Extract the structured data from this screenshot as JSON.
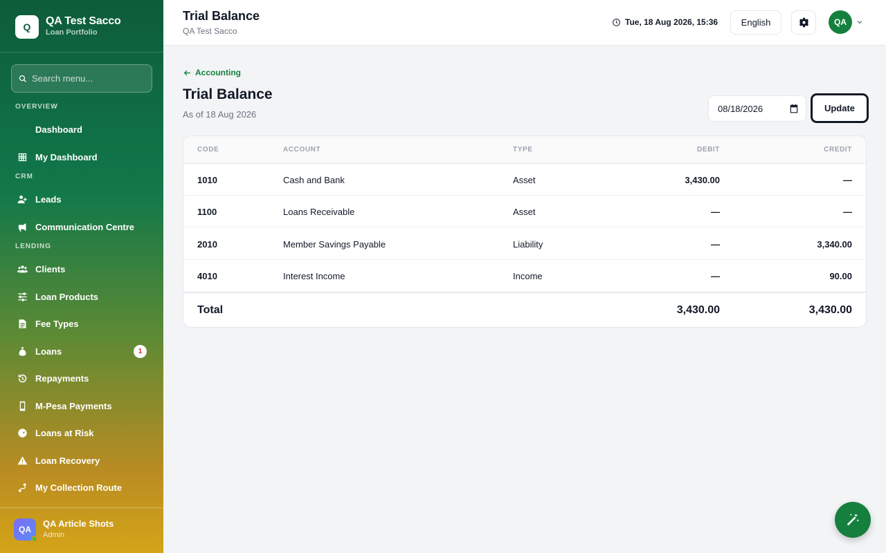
{
  "brand": {
    "logo_letter": "Q",
    "title": "QA Test Sacco",
    "subtitle": "Loan Portfolio"
  },
  "search": {
    "placeholder": "Search menu..."
  },
  "sections": {
    "overview": "OVERVIEW",
    "crm": "CRM",
    "lending": "LENDING"
  },
  "nav": [
    {
      "label": "Dashboard",
      "icon": "none"
    },
    {
      "label": "My Dashboard",
      "icon": "grid-icon"
    },
    {
      "label": "Leads",
      "icon": "user-plus-icon"
    },
    {
      "label": "Communication Centre",
      "icon": "megaphone-icon"
    },
    {
      "label": "Clients",
      "icon": "users-icon"
    },
    {
      "label": "Loan Products",
      "icon": "sliders-icon"
    },
    {
      "label": "Fee Types",
      "icon": "document-icon"
    },
    {
      "label": "Loans",
      "icon": "money-bag-icon",
      "badge": "1"
    },
    {
      "label": "Repayments",
      "icon": "history-icon"
    },
    {
      "label": "M-Pesa Payments",
      "icon": "mobile-icon"
    },
    {
      "label": "Loans at Risk",
      "icon": "gauge-icon"
    },
    {
      "label": "Loan Recovery",
      "icon": "warning-icon"
    },
    {
      "label": "My Collection Route",
      "icon": "route-icon"
    }
  ],
  "user": {
    "initials": "QA",
    "name": "QA Article Shots",
    "role": "Admin"
  },
  "header": {
    "title": "Trial Balance",
    "subtitle": "QA Test Sacco",
    "datetime": "Tue, 18 Aug 2026, 15:36",
    "language": "English",
    "avatar_initials": "QA"
  },
  "page": {
    "back_label": "Accounting",
    "title": "Trial Balance",
    "subtitle": "As of 18 Aug 2026",
    "date_value": "08/18/2026",
    "update_label": "Update"
  },
  "table": {
    "columns": {
      "code": "CODE",
      "account": "ACCOUNT",
      "type": "TYPE",
      "debit": "DEBIT",
      "credit": "CREDIT"
    },
    "rows": [
      {
        "code": "1010",
        "account": "Cash and Bank",
        "type": "Asset",
        "debit": "3,430.00",
        "credit": "—"
      },
      {
        "code": "1100",
        "account": "Loans Receivable",
        "type": "Asset",
        "debit": "—",
        "credit": "—"
      },
      {
        "code": "2010",
        "account": "Member Savings Payable",
        "type": "Liability",
        "debit": "—",
        "credit": "3,340.00"
      },
      {
        "code": "4010",
        "account": "Interest Income",
        "type": "Income",
        "debit": "—",
        "credit": "90.00"
      }
    ],
    "total": {
      "label": "Total",
      "debit": "3,430.00",
      "credit": "3,430.00"
    }
  },
  "colors": {
    "accent": "#15803d",
    "sidebar_top": "#0d5c3a",
    "sidebar_bottom": "#d4a418",
    "badge_text": "#dc2626"
  }
}
